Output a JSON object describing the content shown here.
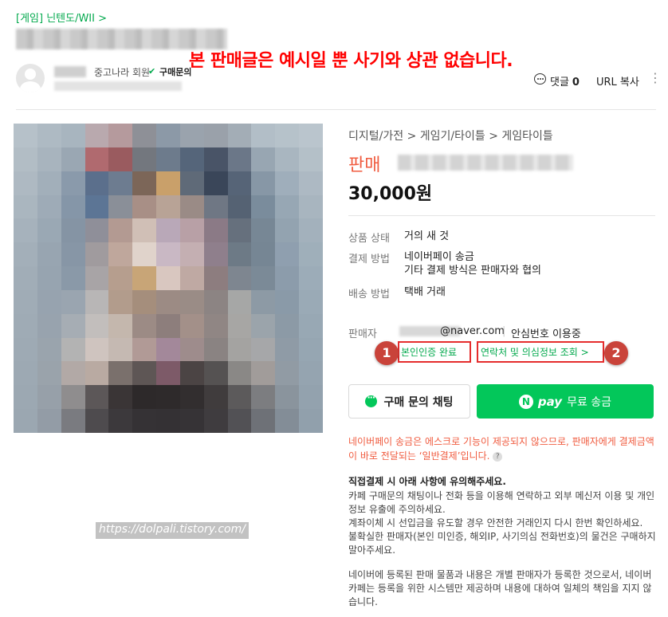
{
  "breadcrumb": {
    "label": "[게임] 닌텐도/WII",
    "chevron": ">"
  },
  "notice": "본 판매글은 예시일 뿐 사기와 상관 없습니다.",
  "author": {
    "grade": "중고나라 회원",
    "buy_label": "구매문의",
    "comment_label": "댓글",
    "comment_count": "0",
    "url_copy": "URL 복사"
  },
  "watermark": "https://dolpali.tistory.com/",
  "product": {
    "category": "디지털/가전 > 게임기/타이틀 > 게임타이틀",
    "sale_label": "판매",
    "price": "30,000원",
    "info": [
      {
        "label": "상품 상태",
        "value": "거의 새 것"
      },
      {
        "label": "결제 방법",
        "value": "네이버페이 송금"
      },
      {
        "label": "",
        "value": "기타 결제 방식은 판매자와 협의"
      },
      {
        "label": "배송 방법",
        "value": "택배 거래"
      }
    ]
  },
  "seller": {
    "label": "판매자",
    "email_domain": "@naver.com",
    "separator": "|",
    "safe_number": "안심번호 이용중",
    "verify_label": "본인인증 완료",
    "contact_label": "연락처 및 의심정보 조회 >"
  },
  "badges": [
    "1",
    "2"
  ],
  "buttons": {
    "chat_label": "구매 문의 채팅",
    "npay_n": "N",
    "npay_pay": "pay",
    "pay_label": "무료 송금"
  },
  "pay_notice": "네이버페이 송금은 에스크로 기능이 제공되지 않으므로, 판매자에게 결제금액이 바로 전달되는 ‘일반결제’입니다.",
  "help_icon": "?",
  "caution": {
    "title": "직접결제 시 아래 사항에 유의해주세요.",
    "lines": [
      "카페 구매문의 채팅이나 전화 등을 이용해 연락하고 외부 메신저 이용 및 개인 정보 유출에 주의하세요.",
      "계좌이체 시 선입금을 유도할 경우 안전한 거래인지 다시 한번 확인하세요.",
      "불확실한 판매자(본인 미인증, 해외IP, 사기의심 전화번호)의 물건은 구매하지 말아주세요."
    ]
  },
  "disclaimer": "네이버에 등록된 판매 물품과 내용은 개별 판매자가 등록한 것으로서, 네이버카페는 등록을 위한 시스템만 제공하며 내용에 대하여 일체의 책임을 지지 않습니다.",
  "colors": {
    "accent_green": "#03c75a",
    "link_green": "#03a94d",
    "sale_orange": "#f05b3f",
    "notice_red": "#ff0000",
    "badge_red": "#c9433a"
  }
}
